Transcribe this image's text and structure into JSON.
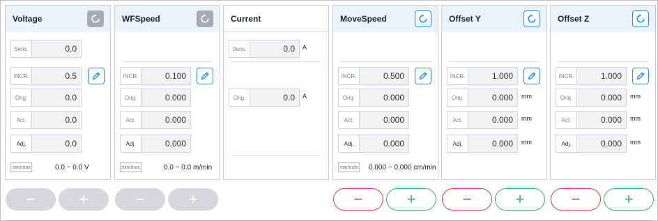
{
  "panels": {
    "voltage": {
      "title": "Voltage",
      "sens_label": "Sens.",
      "sens_value": "0.0",
      "incr_label": "INCR.",
      "incr_value": "0.5",
      "orig_label": "Orig.",
      "orig_value": "0.0",
      "act_label": "Act.",
      "act_value": "0.0",
      "adj_label": "Adj.",
      "adj_value": "0.0",
      "minmax_label": "min/max",
      "range": "0.0 ~ 0.0",
      "range_unit": "V"
    },
    "wfspeed": {
      "title": "WFSpeed",
      "incr_label": "INCR.",
      "incr_value": "0.100",
      "orig_label": "Orig.",
      "orig_value": "0.000",
      "act_label": "Act.",
      "act_value": "0.000",
      "adj_label": "Adj.",
      "adj_value": "0.000",
      "minmax_label": "min/max",
      "range": "0.0 ~ 0.0",
      "range_unit": "m/min"
    },
    "current": {
      "title": "Current",
      "sens_label": "Sens.",
      "sens_value": "0.0",
      "sens_unit": "A",
      "orig_label": "Orig.",
      "orig_value": "0.0",
      "orig_unit": "A"
    },
    "movespeed": {
      "title": "MoveSpeed",
      "incr_label": "INCR.",
      "incr_value": "0.500",
      "orig_label": "Orig.",
      "orig_value": "0.000",
      "act_label": "Act.",
      "act_value": "0.000",
      "adj_label": "Adj.",
      "adj_value": "0.000",
      "minmax_label": "min/max",
      "range": "0.000 ~ 0.000",
      "range_unit": "cm/min"
    },
    "offset_y": {
      "title": "Offset Y",
      "incr_label": "INCR.",
      "incr_value": "1.000",
      "orig_label": "Orig.",
      "orig_value": "0.000",
      "orig_unit": "mm",
      "act_label": "Act.",
      "act_value": "0.000",
      "act_unit": "mm",
      "adj_label": "Adj.",
      "adj_value": "0.000",
      "adj_unit": "mm"
    },
    "offset_z": {
      "title": "Offset Z",
      "incr_label": "INCR.",
      "incr_value": "1.000",
      "orig_label": "Orig.",
      "orig_value": "0.000",
      "orig_unit": "mm",
      "act_label": "Act.",
      "act_value": "0.000",
      "act_unit": "mm",
      "adj_label": "Adj.",
      "adj_value": "0.000",
      "adj_unit": "mm"
    }
  },
  "buttons": {
    "minus_symbol": "−",
    "plus_symbol": "+"
  },
  "icons": {
    "reset": "reset-icon",
    "edit": "pencil-icon"
  },
  "colors": {
    "accent_blue": "#2f8ee8",
    "minus_red": "#d9434a",
    "plus_green": "#3fae6b",
    "disabled_gray": "#d6d8db",
    "header_bg": "#eaf2fb"
  }
}
